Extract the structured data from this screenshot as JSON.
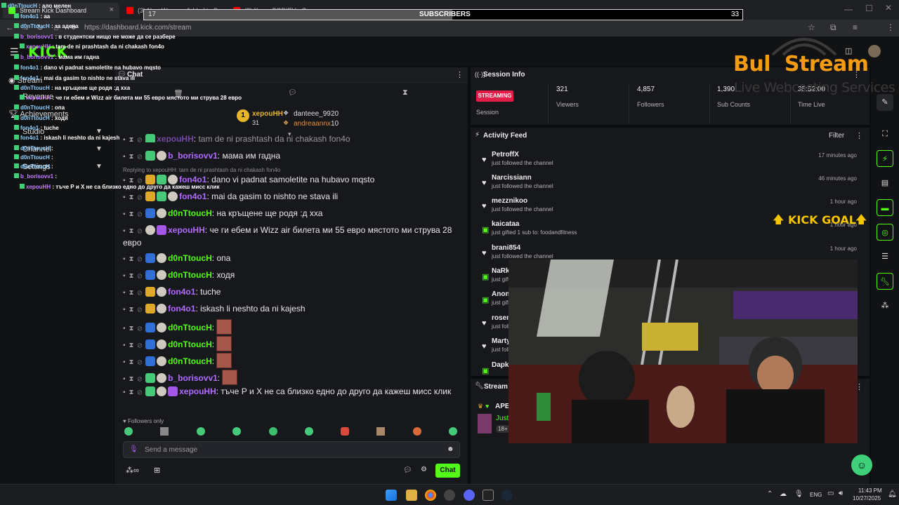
{
  "browser": {
    "tabs": [
      {
        "label": "Stream Kick Dashboard"
      },
      {
        "label": "(3) New Weapon Added to Sp..."
      },
      {
        "label": "(3) Xarsa BODIEV - Самая..."
      }
    ],
    "url": "https://dashboard.kick.com/stream"
  },
  "overlay": {
    "subs_bar": {
      "left": "17",
      "label": "SUBSCRIBERS",
      "right": "33",
      "progress": 0.515
    },
    "brand_main": "Bul  Stream",
    "brand_sub": "Live Webcasting Services",
    "kick_goal": "KICK GOAL",
    "chat_lines": [
      {
        "user": "d0nTtoucH",
        "text": "ало мелен"
      },
      {
        "user": "fon4o1",
        "text": "аа"
      },
      {
        "user": "d0nTtoucH",
        "text": "за адена"
      },
      {
        "user": "b_borisovv1",
        "text": "в студентски нищо не може да се разбере"
      },
      {
        "user": "xepouHH",
        "text": "tam de ni prashtash da ni chakash fon4o"
      },
      {
        "user": "b_borisovv1",
        "text": "мама им гадна"
      },
      {
        "user": "fon4o1",
        "text": "dano vi padnat samoletite na hubavo mqsto"
      },
      {
        "user": "fon4o1",
        "text": "mai da gasim to nishto ne stava ili"
      },
      {
        "user": "d0nTtoucH",
        "text": "на кръщене ще родя :д хха"
      },
      {
        "user": "xepouHH",
        "text": "че ги ебем и Wizz air билета ми 55 евро мястото ми струва 28 евро"
      },
      {
        "user": "d0nTtoucH",
        "text": "опа"
      },
      {
        "user": "d0nTtoucH",
        "text": "ходя"
      },
      {
        "user": "fon4o1",
        "text": "tuche"
      },
      {
        "user": "fon4o1",
        "text": "iskash li neshto da ni kajesh"
      },
      {
        "user": "d0nTtoucH",
        "text": ""
      },
      {
        "user": "d0nTtoucH",
        "text": ""
      },
      {
        "user": "d0nTtoucH",
        "text": ""
      },
      {
        "user": "b_borisovv1",
        "text": ""
      },
      {
        "user": "xepouHH",
        "text": "тъче Р и Х не са близко едно до друго да кажеш мисс клик"
      }
    ]
  },
  "sidebar": {
    "items": [
      {
        "label": "Stream"
      },
      {
        "label": "Revenue"
      },
      {
        "label": "Achievements"
      },
      {
        "label": "Studio"
      },
      {
        "label": "Channel"
      },
      {
        "label": "Settings"
      }
    ]
  },
  "chat": {
    "title": "Chat",
    "leaderboard": {
      "first_name": "xepouHH",
      "first_count": "31",
      "second_name": "danteee_99",
      "second_count": "20",
      "third_name": "andreaannx",
      "third_count": "10"
    },
    "top_message": "tam de ni prashtash da ni chakash fon4o",
    "reply_note": "Replying to xepouHH: tam de ni prashtash da ni chakash fon4o",
    "messages": [
      {
        "user": "b_borisovv1",
        "text": "мама им гадна"
      },
      {
        "user": "fon4o1",
        "text": "dano vi padnat samoletite na hubavo mqsto"
      },
      {
        "user": "fon4o1",
        "text": "mai da gasim to nishto ne stava ili"
      },
      {
        "user": "d0nTtoucH",
        "text": "на кръщене ще родя :д хха"
      },
      {
        "user": "xepouHH",
        "text": "че ги ебем и Wizz air билета ми 55 евро мястото ми струва 28 евро"
      },
      {
        "user": "d0nTtoucH",
        "text": "опа"
      },
      {
        "user": "d0nTtoucH",
        "text": "ходя"
      },
      {
        "user": "fon4o1",
        "text": "tuche"
      },
      {
        "user": "fon4o1",
        "text": "iskash li neshto da ni kajesh"
      },
      {
        "user": "d0nTtoucH",
        "text": ""
      },
      {
        "user": "d0nTtoucH",
        "text": ""
      },
      {
        "user": "d0nTtoucH",
        "text": ""
      },
      {
        "user": "b_borisovv1",
        "text": ""
      },
      {
        "user": "xepouHH",
        "text": "тъче Р и Х не са близко едно до друго да кажеш мисс клик"
      }
    ],
    "followers_only": "Followers only",
    "input_placeholder": "Send a message",
    "send_label": "Chat"
  },
  "session": {
    "title": "Session Info",
    "status": "STREAMING",
    "status_label": "Session",
    "stats": [
      {
        "value": "321",
        "label": "Viewers"
      },
      {
        "value": "4,857",
        "label": "Followers"
      },
      {
        "value": "1,390",
        "label": "Sub Counts"
      },
      {
        "value": "35:52:00",
        "label": "Time Live"
      }
    ]
  },
  "activity": {
    "title": "Activity Feed",
    "filter_label": "Filter",
    "items": [
      {
        "name": "PetroffX",
        "sub": "just followed the channel",
        "time": "17 minutes ago",
        "kind": "follow"
      },
      {
        "name": "Narcissiann",
        "sub": "just followed the channel",
        "time": "46 minutes ago",
        "kind": "follow"
      },
      {
        "name": "mezznikoo",
        "sub": "just followed the channel",
        "time": "1 hour ago",
        "kind": "follow"
      },
      {
        "name": "kaicataa",
        "sub": "just gifted 1 sub to: foodandfitness",
        "time": "1 hour ago",
        "kind": "gift"
      },
      {
        "name": "brani854",
        "sub": "just followed the channel",
        "time": "1 hour ago",
        "kind": "follow"
      },
      {
        "name": "NaRk",
        "sub": "just gift",
        "time": "",
        "kind": "gift"
      },
      {
        "name": "Anony",
        "sub": "just gift",
        "time": "",
        "kind": "gift"
      },
      {
        "name": "rosen",
        "sub": "just foll",
        "time": "",
        "kind": "follow"
      },
      {
        "name": "Marty",
        "sub": "just foll",
        "time": "",
        "kind": "follow"
      },
      {
        "name": "Dapko",
        "sub": "",
        "time": "",
        "kind": "gift"
      }
    ]
  },
  "stream_panel": {
    "title": "Stream i",
    "user": "APE",
    "line": "Just",
    "tag": "18+"
  },
  "taskbar": {
    "lang": "ENG",
    "time": "11:43 PM",
    "date": "10/27/2025"
  },
  "colors": {
    "kick_green": "#53fc18",
    "streaming_red": "#e11d48",
    "brand_orange": "#f39c12"
  }
}
